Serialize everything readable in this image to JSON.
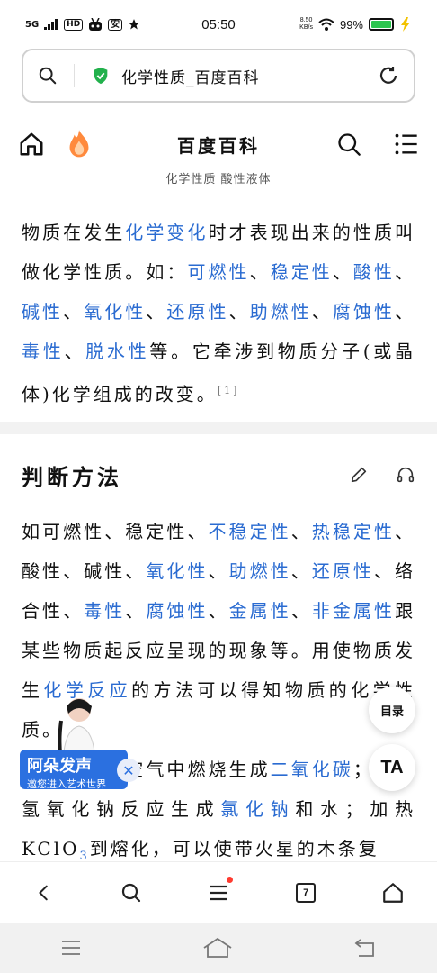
{
  "status": {
    "time": "05:50",
    "network": "5G",
    "hd": "HD",
    "app_badge": "安",
    "speed_value": "8.50",
    "speed_unit": "KB/s",
    "battery": "99%",
    "battery_color": "#2cc44e"
  },
  "urlbar": {
    "title": "化学性质_百度百科"
  },
  "sitenav": {
    "title": "百度百科"
  },
  "caption": "化学性质 酸性液体",
  "intro": {
    "t1": "物质在发生",
    "l1": "化学变化",
    "t2": "时才表现出来的性质叫做化学性质。如：",
    "l2": "可燃性",
    "s1": "、",
    "l3": "稳定性",
    "s2": "、",
    "l4": "酸性",
    "s3": "、",
    "l5": "碱性",
    "s4": "、",
    "l6": "氧化性",
    "s5": "、",
    "l7": "还原性",
    "s6": "、",
    "l8": "助燃性",
    "s7": "、",
    "l9": "腐蚀性",
    "s8": "、",
    "l10": "毒性",
    "s9": "、",
    "l11": "脱水性",
    "t3": "等。它牵涉到物质分子(或晶体)化学组成的改变。",
    "ref": "[1]"
  },
  "section": {
    "title": "判断方法"
  },
  "method": {
    "t1": "如可燃性、稳定性、",
    "l1": "不稳定性",
    "s1": "、",
    "l2": "热稳定性",
    "t2": "、酸性、碱性、",
    "l3": "氧化性",
    "s2": "、",
    "l4": "助燃性",
    "s3": "、",
    "l5": "还原性",
    "t3": "、络合性、",
    "l6": "毒性",
    "s4": "、",
    "l7": "腐蚀性",
    "s5": "、",
    "l8": "金属性",
    "s6": "、",
    "l9": "非金属性",
    "t4": "跟某些物质起反应呈现的现象等。用使物质发生",
    "l10": "化学反应",
    "t5": "的方法可以得知物质的化学性质。"
  },
  "example": {
    "t1": "例如：碳在空气中燃烧生成",
    "l1": "二氧化碳",
    "t2": "；酸与氢氧化钠反应生成",
    "l2": "氯化钠",
    "t3": "和水；加热KClO",
    "sub": "3",
    "t4": "到熔化，可以使带火星的木条复"
  },
  "floating": {
    "toc": "目录",
    "ta": "TA"
  },
  "promo": {
    "title": "阿朵发声",
    "subtitle": "邀您进入艺术世界"
  },
  "toolbar": {
    "tab_count": "7"
  },
  "colors": {
    "link": "#2a6bd1",
    "promo": "#2b70e0",
    "notify_dot": "#ff3b30"
  }
}
